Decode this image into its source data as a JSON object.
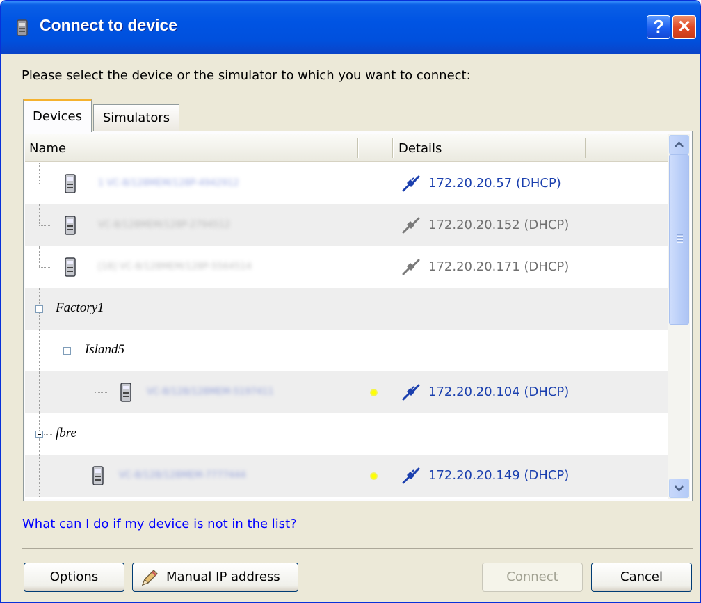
{
  "window": {
    "title": "Connect to device",
    "help_glyph": "?",
    "close_glyph": "✕"
  },
  "prompt": "Please select the device or the simulator to which you want to connect:",
  "tabs": [
    {
      "label": "Devices",
      "selected": true
    },
    {
      "label": "Simulators",
      "selected": false
    }
  ],
  "columns": {
    "name": "Name",
    "details": "Details"
  },
  "rows": [
    {
      "kind": "device",
      "name": "1 VC-8/128MEM/128P-4942912",
      "ip": "172.20.20.57 (DHCP)",
      "connected": true
    },
    {
      "kind": "device",
      "name": "VC-8/128MEM/128P-2794512",
      "ip": "172.20.20.152 (DHCP)",
      "connected": false
    },
    {
      "kind": "device",
      "name": "[18] VC-8/128MEM/128P-5564514",
      "ip": "172.20.20.171 (DHCP)",
      "connected": false
    },
    {
      "kind": "group",
      "label": "Factory1"
    },
    {
      "kind": "group",
      "label": "Island5"
    },
    {
      "kind": "device",
      "name": "VC-8/128/128MEM-5197411",
      "ip": "172.20.20.104 (DHCP)",
      "connected": true
    },
    {
      "kind": "group",
      "label": "fbre"
    },
    {
      "kind": "device",
      "name": "VC-8/128/128MEM-7777444",
      "ip": "172.20.20.149 (DHCP)",
      "connected": true
    }
  ],
  "help_link": "What can I do if my device is not in the list?",
  "buttons": {
    "options": "Options",
    "manual_ip": "Manual IP address",
    "connect": "Connect",
    "cancel": "Cancel"
  },
  "colors": {
    "title_bar": "#0054e3",
    "link": "#0000ff",
    "ip_connected": "#1a3fae",
    "ip_disconnected": "#707070",
    "status_led": "#ffff00"
  },
  "icons": {
    "app": "device-icon",
    "help": "help-icon",
    "close": "close-icon",
    "connected": "plug-connected-icon",
    "disconnected": "plug-disconnected-icon",
    "expander": "collapse-icon",
    "pencil": "pencil-icon"
  }
}
